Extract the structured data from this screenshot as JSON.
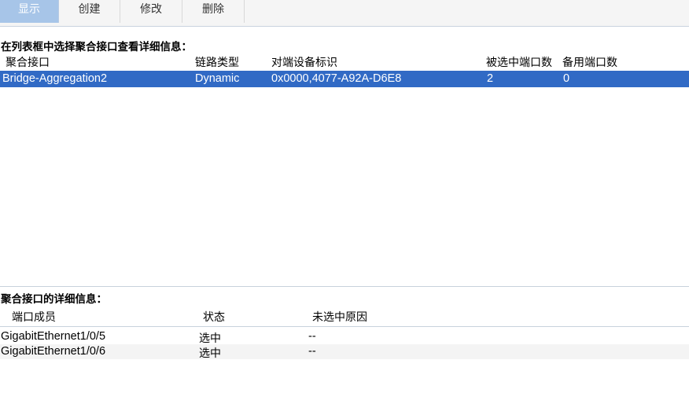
{
  "tabs": [
    "显示",
    "创建",
    "修改",
    "删除"
  ],
  "list_section": {
    "title": "在列表框中选择聚合接口查看详细信息：",
    "columns": [
      "聚合接口",
      "链路类型",
      "对端设备标识",
      "被选中端口数",
      "备用端口数"
    ],
    "rows": [
      {
        "interface": "Bridge-Aggregation2",
        "link_type": "Dynamic",
        "peer_id": "0x0000,4077-A92A-D6E8",
        "selected_ports": "2",
        "standby_ports": "0"
      }
    ]
  },
  "detail_section": {
    "title": "聚合接口的详细信息：",
    "columns": [
      "端口成员",
      "状态",
      "未选中原因"
    ],
    "rows": [
      {
        "member": "GigabitEthernet1/0/5",
        "status": "选中",
        "reason": "--"
      },
      {
        "member": "GigabitEthernet1/0/6",
        "status": "选中",
        "reason": "--"
      }
    ]
  },
  "colors": {
    "tab_active": "#a7c5e8",
    "row_selected": "#316ac5",
    "alt_row": "#f4f4f4"
  }
}
